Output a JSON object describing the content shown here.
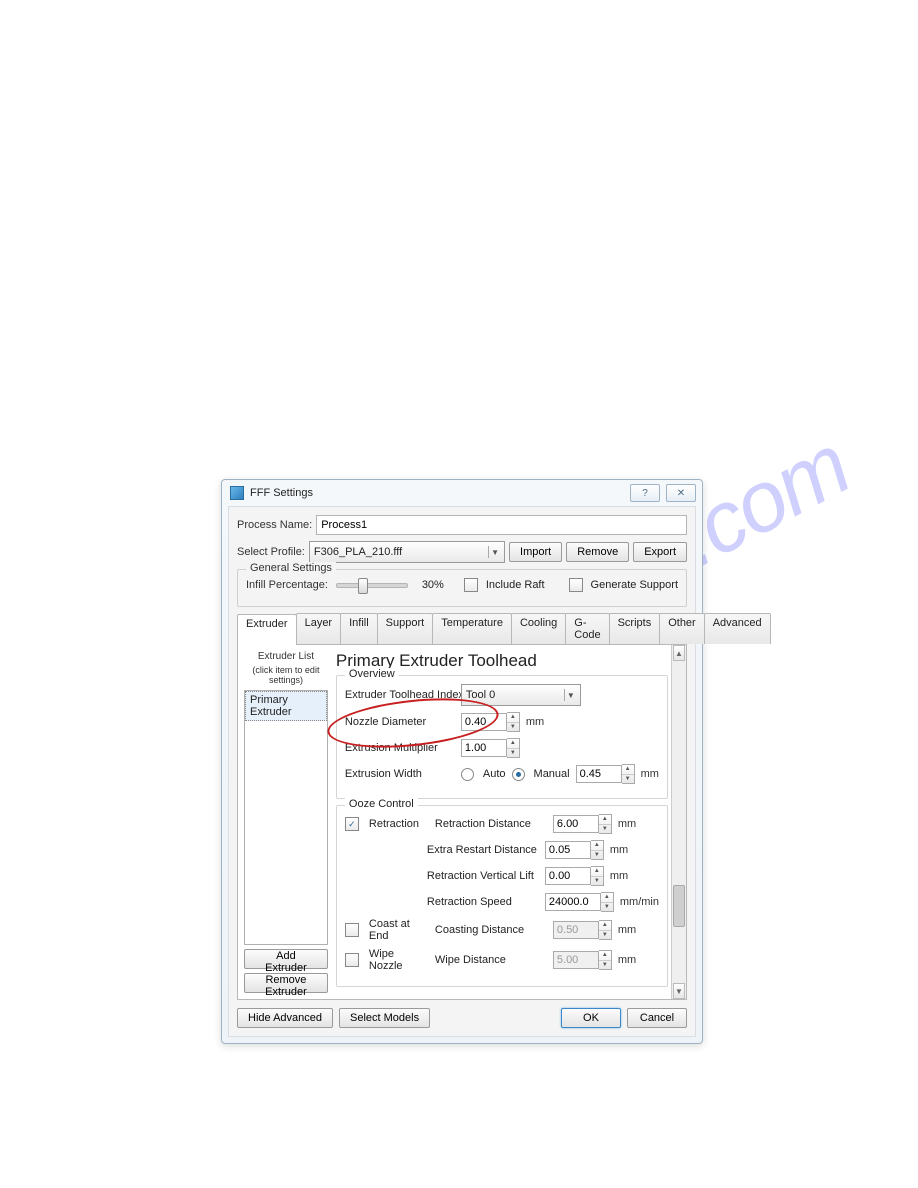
{
  "watermark": "manualshive.com",
  "window": {
    "title": "FFF Settings",
    "help": "?",
    "close": "✕"
  },
  "process": {
    "label": "Process Name:",
    "value": "Process1"
  },
  "profile": {
    "label": "Select Profile:",
    "value": "F306_PLA_210.fff",
    "import": "Import",
    "remove": "Remove",
    "export": "Export"
  },
  "general": {
    "title": "General Settings",
    "infill_label": "Infill Percentage:",
    "infill_value": "30%",
    "include_raft": "Include Raft",
    "generate_support": "Generate Support"
  },
  "tabs": [
    "Extruder",
    "Layer",
    "Infill",
    "Support",
    "Temperature",
    "Cooling",
    "G-Code",
    "Scripts",
    "Other",
    "Advanced"
  ],
  "extruder": {
    "list_title": "Extruder List",
    "list_hint": "(click item to edit settings)",
    "items": [
      "Primary Extruder"
    ],
    "add": "Add Extruder",
    "remove": "Remove Extruder"
  },
  "panel": {
    "heading": "Primary Extruder Toolhead",
    "overview": {
      "title": "Overview",
      "toolhead_label": "Extruder Toolhead Index",
      "toolhead_value": "Tool 0",
      "nozzle_label": "Nozzle Diameter",
      "nozzle_value": "0.40",
      "nozzle_unit": "mm",
      "mult_label": "Extrusion Multiplier",
      "mult_value": "1.00",
      "width_label": "Extrusion Width",
      "width_auto": "Auto",
      "width_manual": "Manual",
      "width_value": "0.45",
      "width_unit": "mm"
    },
    "ooze": {
      "title": "Ooze Control",
      "retraction": "Retraction",
      "retraction_distance": "Retraction Distance",
      "retraction_distance_val": "6.00",
      "extra_restart": "Extra Restart Distance",
      "extra_restart_val": "0.05",
      "vert_lift": "Retraction Vertical Lift",
      "vert_lift_val": "0.00",
      "speed": "Retraction Speed",
      "speed_val": "24000.0",
      "speed_unit": "mm/min",
      "coast": "Coast at End",
      "coast_label": "Coasting Distance",
      "coast_val": "0.50",
      "wipe": "Wipe Nozzle",
      "wipe_label": "Wipe Distance",
      "wipe_val": "5.00",
      "mm": "mm"
    }
  },
  "footer": {
    "hide_adv": "Hide Advanced",
    "select_models": "Select Models",
    "ok": "OK",
    "cancel": "Cancel"
  }
}
